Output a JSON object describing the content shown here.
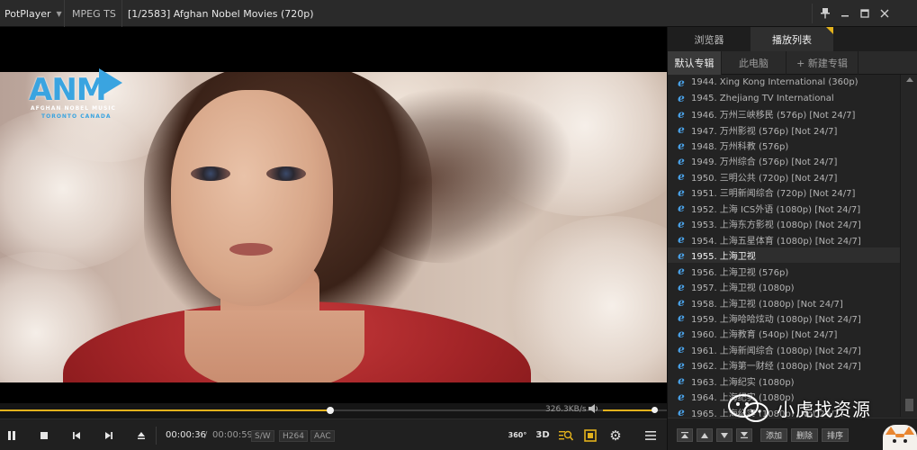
{
  "titlebar": {
    "app_name": "PotPlayer",
    "format": "MPEG TS",
    "file_title": "[1/2583] Afghan Nobel Movies (720p)"
  },
  "video": {
    "channel_logo": {
      "text": "ANM",
      "subtitle_line1": "AFGHAN NOBEL MUSIC",
      "subtitle_line2": "TORONTO CANADA"
    }
  },
  "playback": {
    "progress": 0.495,
    "time_current": "00:00:36",
    "time_separator": "/",
    "time_total": "00:00:59",
    "tag_decoder": "S/W",
    "tag_codec": "H264",
    "tag_audio": "AAC",
    "speed": "326.3KB/s",
    "volume": 1.0
  },
  "controls": {
    "btn_360": "360°",
    "btn_3d": "3D"
  },
  "panel": {
    "tabs": [
      "浏览器",
      "播放列表"
    ],
    "active_tab": 1,
    "albums": [
      "默认专辑",
      "此电脑",
      "+ 新建专辑"
    ],
    "playlist": [
      "1944. Xing Kong International (360p)",
      "1945. Zhejiang TV International",
      "1946. 万州三峡移民 (576p) [Not 24/7]",
      "1947. 万州影视 (576p) [Not 24/7]",
      "1948. 万州科教 (576p)",
      "1949. 万州综合 (576p) [Not 24/7]",
      "1950. 三明公共 (720p) [Not 24/7]",
      "1951. 三明新闻综合 (720p) [Not 24/7]",
      "1952. 上海 ICS外语 (1080p) [Not 24/7]",
      "1953. 上海东方影视 (1080p) [Not 24/7]",
      "1954. 上海五星体育 (1080p) [Not 24/7]",
      "1955. 上海卫视",
      "1956. 上海卫视 (576p)",
      "1957. 上海卫视 (1080p)",
      "1958. 上海卫视 (1080p) [Not 24/7]",
      "1959. 上海哈哈炫动 (1080p) [Not 24/7]",
      "1960. 上海教育 (540p) [Not 24/7]",
      "1961. 上海新闻综合 (1080p) [Not 24/7]",
      "1962. 上海第一财经 (1080p) [Not 24/7]",
      "1963. 上海纪实 (1080p)",
      "1964. 上海纪实 (1080p)",
      "1965. 上海纪实 (1080p) [Not 24/7]"
    ],
    "active_index": 11,
    "footer": {
      "add": "添加",
      "delete": "删除",
      "sort": "排序"
    }
  },
  "watermark": {
    "text": "小虎找资源"
  },
  "colors": {
    "accent": "#e3b21c",
    "ie_icon": "#4aa3ea"
  },
  "icons": {
    "playlist_item": "ie-icon"
  }
}
